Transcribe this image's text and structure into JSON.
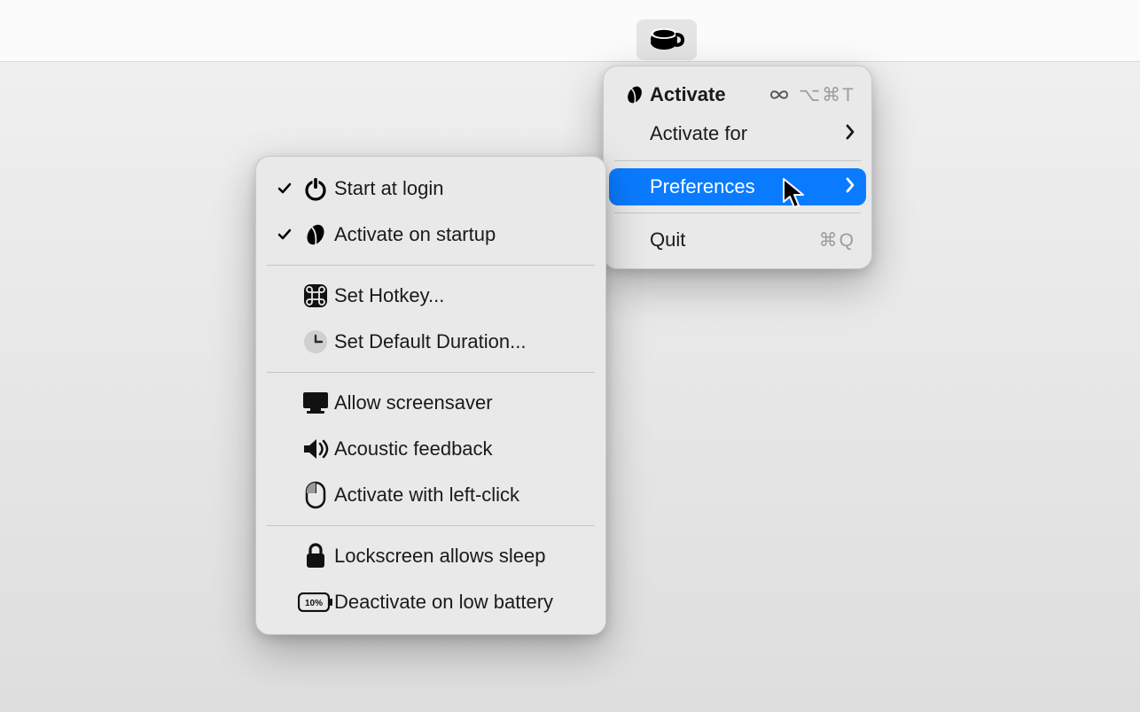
{
  "colors": {
    "highlight": "#0a7bff"
  },
  "menubar": {
    "app_icon": "coffee-cup"
  },
  "main_menu": {
    "activate": {
      "label": "Activate",
      "shortcut": "⌥⌘T",
      "infinity": "∞"
    },
    "activate_for": {
      "label": "Activate for"
    },
    "preferences": {
      "label": "Preferences"
    },
    "quit": {
      "label": "Quit",
      "shortcut": "⌘Q"
    }
  },
  "sub_menu": {
    "start_at_login": {
      "label": "Start at login",
      "checked": true
    },
    "activate_on_startup": {
      "label": "Activate on startup",
      "checked": true
    },
    "set_hotkey": {
      "label": "Set Hotkey..."
    },
    "set_default_duration": {
      "label": "Set Default Duration..."
    },
    "allow_screensaver": {
      "label": "Allow screensaver"
    },
    "acoustic_feedback": {
      "label": "Acoustic feedback"
    },
    "activate_left_click": {
      "label": "Activate with left-click"
    },
    "lockscreen_sleep": {
      "label": "Lockscreen allows sleep"
    },
    "deactivate_low_battery": {
      "label": "Deactivate on low battery",
      "battery_text": "10%"
    }
  }
}
